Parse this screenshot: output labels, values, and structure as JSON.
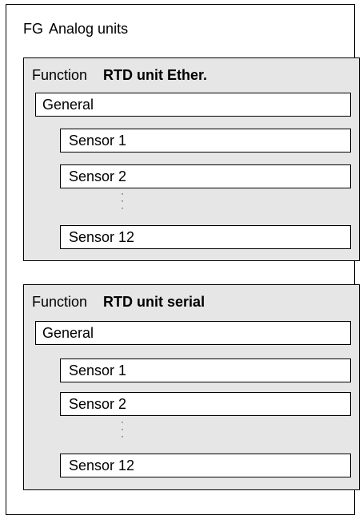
{
  "fg": {
    "keyword": "FG",
    "name": "Analog units"
  },
  "functions": [
    {
      "keyword": "Function",
      "name": "RTD unit Ether.",
      "general": "General",
      "sensors": [
        "Sensor 1",
        "Sensor 2",
        "Sensor 12"
      ],
      "ellipsis": "·\n·\n·"
    },
    {
      "keyword": "Function",
      "name": "RTD unit serial",
      "general": "General",
      "sensors": [
        "Sensor 1",
        "Sensor 2",
        "Sensor 12"
      ],
      "ellipsis": "·\n·\n·"
    }
  ]
}
